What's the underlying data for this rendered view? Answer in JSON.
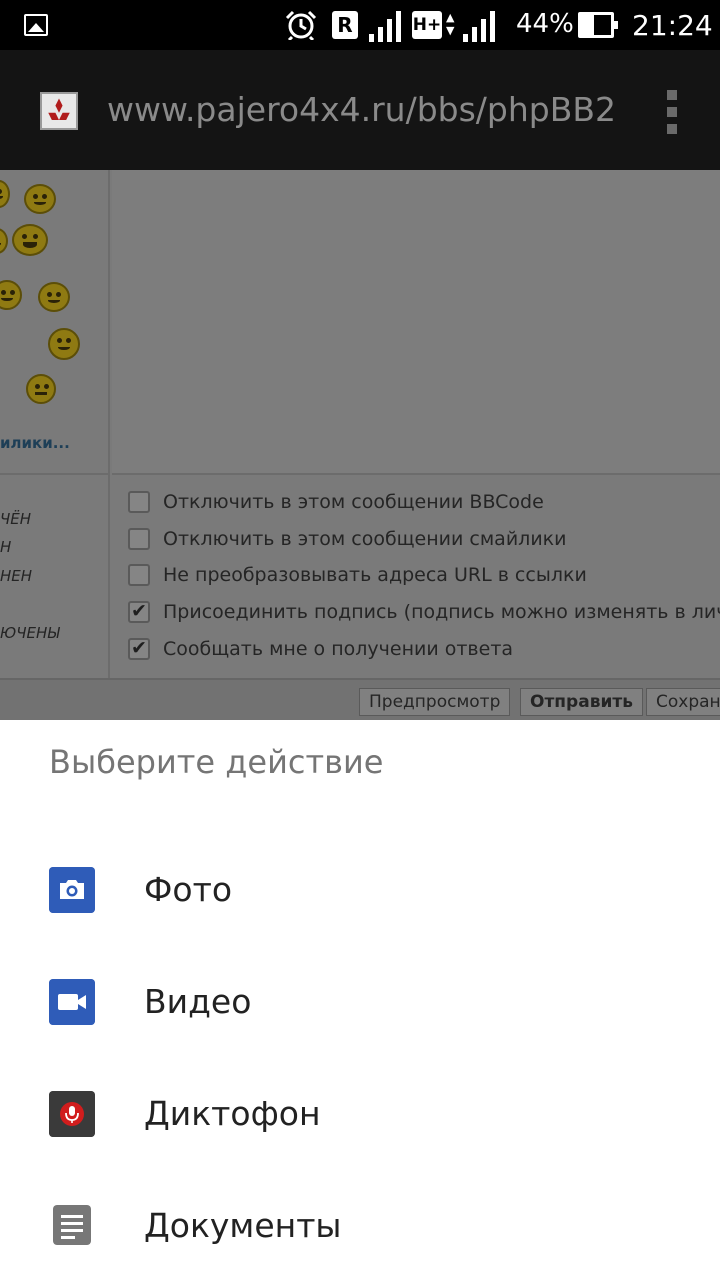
{
  "status_bar": {
    "left_icon": "image-icon",
    "icons": [
      "alarm-icon",
      "roaming-icon",
      "signal-icon",
      "hplus-icon",
      "signal-icon"
    ],
    "roaming_badge": "R",
    "network_type": "H+",
    "battery_percent": "44%",
    "battery_level": 0.44,
    "time": "21:24"
  },
  "browser": {
    "url": "www.pajero4x4.ru/bbs/phpBB2",
    "favicon": "mitsubishi-logo-icon",
    "menu_icon": "overflow-menu-icon"
  },
  "webpage": {
    "more_smilies_link": "илики...",
    "left_status": [
      "ЧЁН",
      "Н",
      "НЕН",
      "ЮЧЕНЫ"
    ],
    "options": [
      {
        "label": "Отключить в этом сообщении BBCode",
        "checked": false
      },
      {
        "label": "Отключить в этом сообщении смайлики",
        "checked": false
      },
      {
        "label": "Не преобразовывать адреса URL в ссылки",
        "checked": false
      },
      {
        "label": "Присоединить подпись (подпись можно изменять в личном",
        "checked": true
      },
      {
        "label": "Сообщать мне о получении ответа",
        "checked": true
      }
    ],
    "buttons": {
      "preview": "Предпросмотр",
      "submit": "Отправить",
      "save": "Сохран"
    }
  },
  "sheet": {
    "title": "Выберите действие",
    "actions": [
      {
        "label": "Фото",
        "icon": "camera-icon",
        "color": "#2f5cb8"
      },
      {
        "label": "Видео",
        "icon": "video-camera-icon",
        "color": "#2f5cb8"
      },
      {
        "label": "Диктофон",
        "icon": "microphone-icon",
        "color": "#3a3a3a"
      },
      {
        "label": "Документы",
        "icon": "document-icon",
        "color": "#777777"
      }
    ]
  }
}
